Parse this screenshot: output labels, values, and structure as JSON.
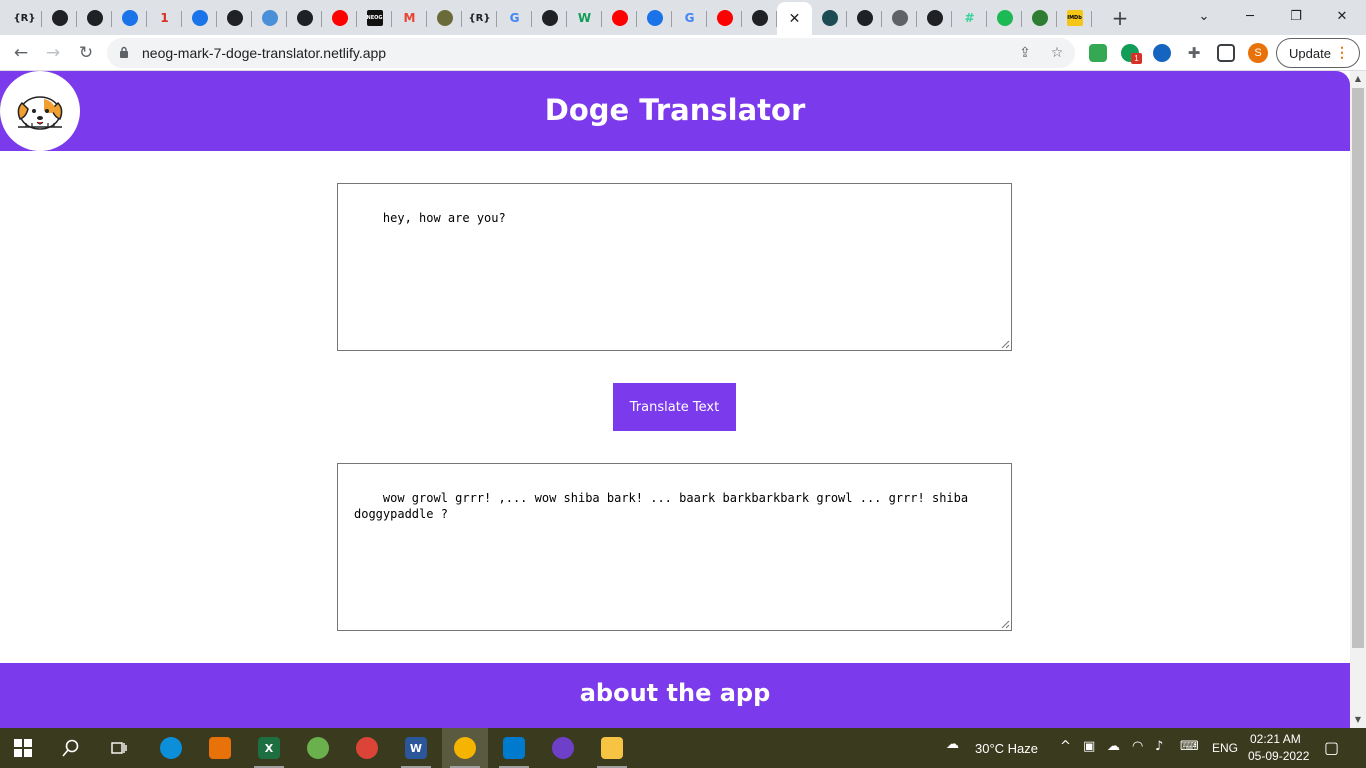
{
  "browser": {
    "tabs": [
      {
        "icon": "r-icon",
        "glyph": "{R}",
        "color": "#202124"
      },
      {
        "icon": "github-icon",
        "glyph": "",
        "color": "#202124"
      },
      {
        "icon": "github-icon",
        "glyph": "",
        "color": "#202124"
      },
      {
        "icon": "power-icon",
        "glyph": "",
        "color": "#1a73e8"
      },
      {
        "icon": "notification-app-icon",
        "glyph": "1",
        "color": "#d93025"
      },
      {
        "icon": "diamond-icon",
        "glyph": "",
        "color": "#1a73e8"
      },
      {
        "icon": "github-icon",
        "glyph": "",
        "color": "#202124"
      },
      {
        "icon": "laptop-icon",
        "glyph": "",
        "color": "#4a90d9"
      },
      {
        "icon": "github-icon",
        "glyph": "",
        "color": "#202124"
      },
      {
        "icon": "youtube-icon",
        "glyph": "",
        "color": "#ff0000"
      },
      {
        "icon": "neog-icon",
        "glyph": "NEOG",
        "color": "#111111"
      },
      {
        "icon": "gmail-icon",
        "glyph": "M",
        "color": "#ea4335"
      },
      {
        "icon": "image-icon",
        "glyph": "",
        "color": "#6b6b3a"
      },
      {
        "icon": "r-icon",
        "glyph": "{R}",
        "color": "#202124"
      },
      {
        "icon": "google-icon",
        "glyph": "G",
        "color": "#4285f4"
      },
      {
        "icon": "github-icon",
        "glyph": "",
        "color": "#202124"
      },
      {
        "icon": "w-icon",
        "glyph": "W",
        "color": "#0f9d58"
      },
      {
        "icon": "youtube-icon",
        "glyph": "",
        "color": "#ff0000"
      },
      {
        "icon": "swirl-icon",
        "glyph": "",
        "color": "#1a73e8"
      },
      {
        "icon": "google-icon",
        "glyph": "G",
        "color": "#4285f4"
      },
      {
        "icon": "youtube-icon",
        "glyph": "",
        "color": "#ff0000"
      },
      {
        "icon": "github-icon",
        "glyph": "",
        "color": "#202124"
      },
      {
        "icon": "close-icon",
        "glyph": "✕",
        "color": "#202124",
        "active": true
      },
      {
        "icon": "netlify-icon",
        "glyph": "",
        "color": "#1d4c54"
      },
      {
        "icon": "github-icon",
        "glyph": "",
        "color": "#202124"
      },
      {
        "icon": "globe-icon",
        "glyph": "",
        "color": "#5f6368"
      },
      {
        "icon": "document-icon",
        "glyph": "",
        "color": "#202124"
      },
      {
        "icon": "hash-icon",
        "glyph": "#",
        "color": "#34d399"
      },
      {
        "icon": "spotify-icon",
        "glyph": "",
        "color": "#1db954"
      },
      {
        "icon": "globe-icon",
        "glyph": "",
        "color": "#2e7d32"
      },
      {
        "icon": "imdb-icon",
        "glyph": "IMDb",
        "color": "#f5c518"
      }
    ],
    "url": "neog-mark-7-doge-translator.netlify.app",
    "update_label": "Update",
    "avatar_initial": "S",
    "extension_badge": "1"
  },
  "app": {
    "title": "Doge Translator",
    "input_text": "hey, how are you?",
    "button_label": "Translate Text",
    "output_text": "wow growl grrr! ,... wow shiba bark! ... baark barkbarkbark growl ... grrr! shiba doggypaddle ?",
    "footer_title": "about the app",
    "colors": {
      "primary": "#7c3aed",
      "background": "#ffffff"
    }
  },
  "taskbar": {
    "apps": [
      {
        "name": "edge",
        "icon": "edge-icon",
        "color": "#0c8ed9",
        "glyph": ""
      },
      {
        "name": "paint",
        "icon": "paint-icon",
        "color": "#e8710a",
        "glyph": ""
      },
      {
        "name": "excel",
        "icon": "excel-icon",
        "color": "#1d6f42",
        "glyph": "X"
      },
      {
        "name": "maps",
        "icon": "map-app-icon",
        "color": "#6ab04c",
        "glyph": ""
      },
      {
        "name": "chrome",
        "icon": "chrome-icon",
        "color": "#db4437",
        "glyph": ""
      },
      {
        "name": "word",
        "icon": "word-icon",
        "color": "#2b579a",
        "glyph": "W"
      },
      {
        "name": "chrome-canary",
        "icon": "chrome-icon",
        "color": "#f4b400",
        "glyph": "",
        "active": true
      },
      {
        "name": "vscode",
        "icon": "vscode-icon",
        "color": "#007acc",
        "glyph": ""
      },
      {
        "name": "github-desktop",
        "icon": "github-desktop-icon",
        "color": "#6e40c9",
        "glyph": ""
      },
      {
        "name": "file-explorer",
        "icon": "folder-icon",
        "color": "#f6c342",
        "glyph": ""
      }
    ],
    "weather": "30°C  Haze",
    "language": "ENG",
    "time": "02:21 AM",
    "date": "05-09-2022"
  }
}
